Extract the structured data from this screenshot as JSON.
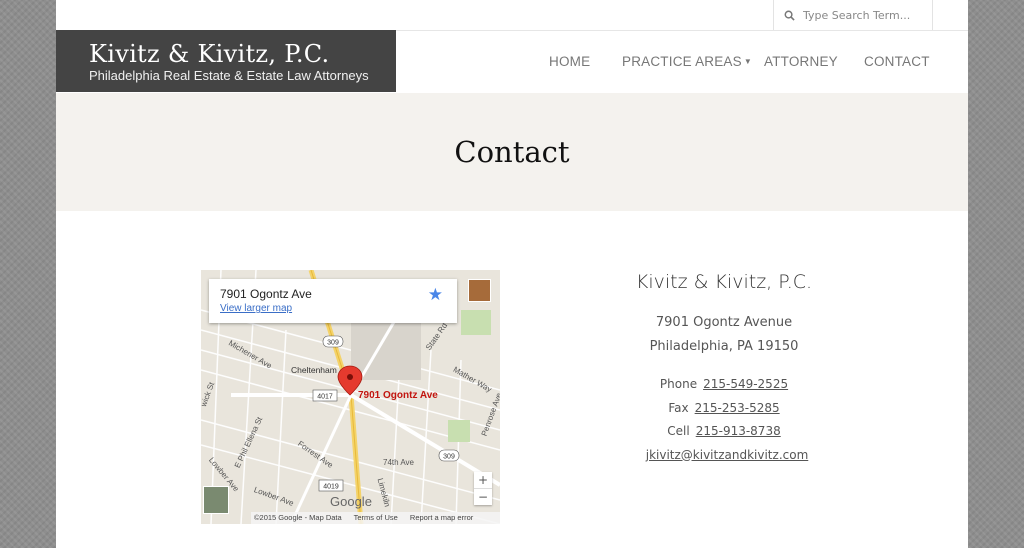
{
  "search": {
    "placeholder": "Type Search Term..."
  },
  "logo": {
    "name": "Kivitz & Kivitz, P.C.",
    "tagline": "Philadelphia Real Estate & Estate Law Attorneys"
  },
  "nav": {
    "items": [
      {
        "label": "HOME"
      },
      {
        "label": "PRACTICE AREAS",
        "has_dropdown": true
      },
      {
        "label": "ATTORNEY"
      },
      {
        "label": "CONTACT"
      }
    ]
  },
  "hero": {
    "title": "Contact"
  },
  "map": {
    "card_address": "7901 Ogontz Ave",
    "card_link": "View larger map",
    "pin_label": "7901 Ogontz Ave",
    "street_labels": [
      "Michener Ave",
      "Cheltenham",
      "State Rd",
      "Mather Way",
      "E Phil Ellena St",
      "Forrest Ave",
      "Lowber Ave",
      "74th Ave",
      "Penrose Ave",
      "Lowber Ave",
      "Limekiln",
      "wick St"
    ],
    "route_shields": [
      "309",
      "4017",
      "309",
      "4019"
    ],
    "google_text": "Google",
    "attribution": [
      "©2015 Google - Map Data",
      "Terms of Use",
      "Report a map error"
    ],
    "zoom_in": "+",
    "zoom_out": "−"
  },
  "contact": {
    "firm": "Kivitz & Kivitz, P.C.",
    "address_line1": "7901 Ogontz Avenue",
    "address_line2": "Philadelphia, PA  19150",
    "phone_label": "Phone",
    "phone": "215-549-2525",
    "fax_label": "Fax",
    "fax": "215-253-5285",
    "cell_label": "Cell",
    "cell": "215-913-8738",
    "email": "jkivitz@kivitzandkivitz.com"
  },
  "colors": {
    "logo_bg": "#444444",
    "hero_bg": "#f4f2ee",
    "pin": "#c2150f",
    "link": "#3a6ec7"
  },
  "icons": {
    "search": "search-icon",
    "star": "star-icon",
    "pin": "map-pin-icon",
    "caret": "caret-down-icon"
  }
}
